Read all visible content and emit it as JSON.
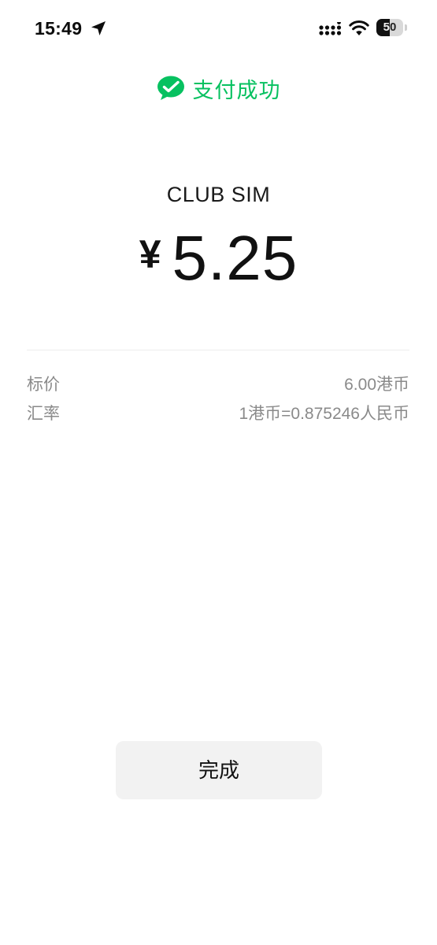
{
  "status_bar": {
    "time": "15:49",
    "battery_level": "50",
    "battery_fraction": 0.5,
    "icons": [
      "location-arrow-icon",
      "cellular-signal-icon",
      "wifi-icon",
      "battery-icon"
    ]
  },
  "header": {
    "success_text": "支付成功",
    "icon": "wechat-pay-icon",
    "accent_color": "#07c160"
  },
  "payment": {
    "merchant": "CLUB SIM",
    "currency_symbol": "¥",
    "amount": "5.25"
  },
  "details": [
    {
      "label": "标价",
      "value": "6.00港币"
    },
    {
      "label": "汇率",
      "value": "1港币=0.875246人民币"
    }
  ],
  "actions": {
    "done_label": "完成"
  }
}
